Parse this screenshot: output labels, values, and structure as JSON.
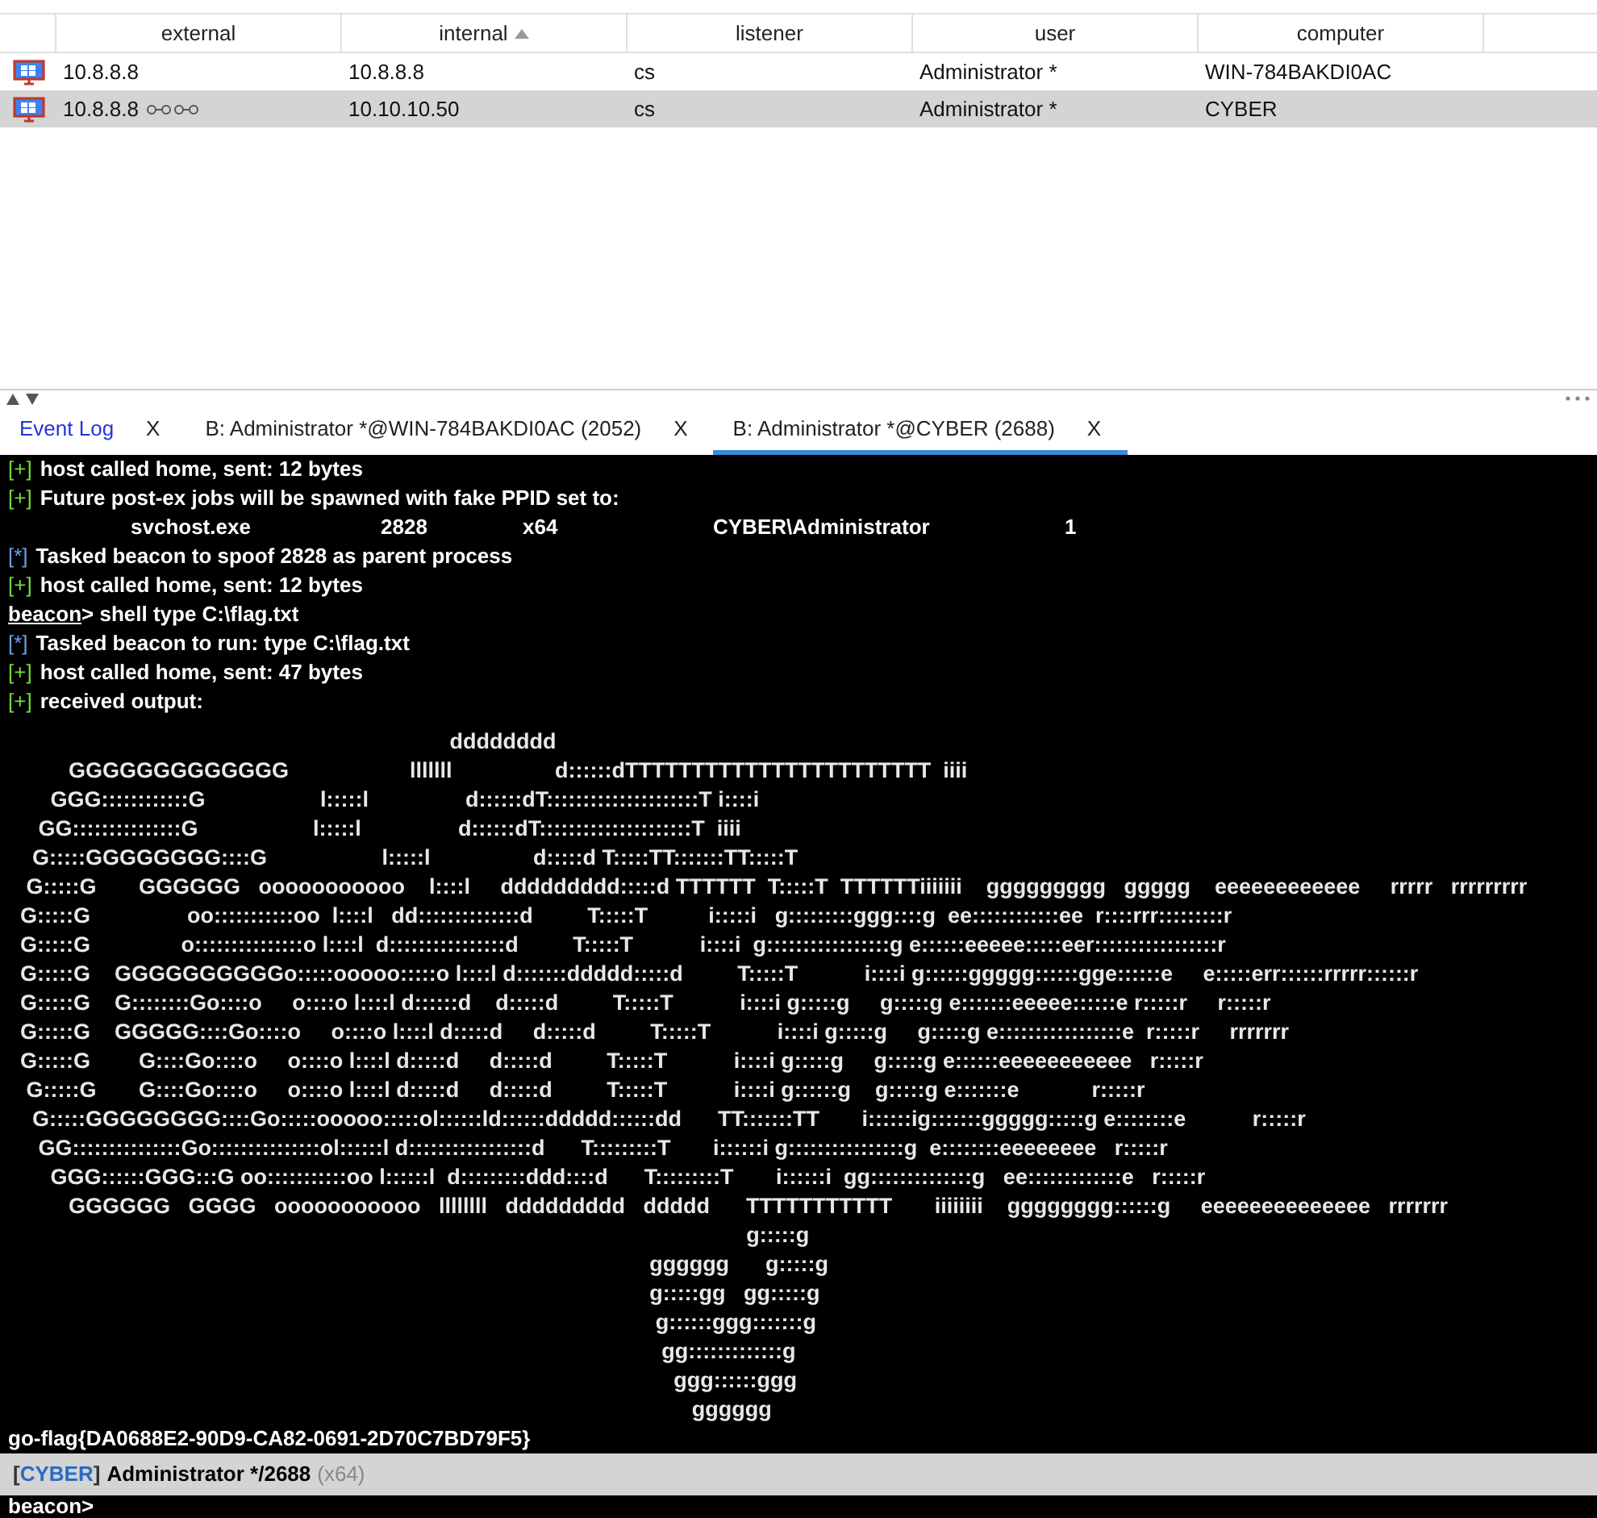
{
  "sessions_table": {
    "columns": [
      {
        "label": "external",
        "sorted": false
      },
      {
        "label": "internal",
        "sorted": true
      },
      {
        "label": "listener",
        "sorted": false
      },
      {
        "label": "user",
        "sorted": false
      },
      {
        "label": "computer",
        "sorted": false
      }
    ],
    "rows": [
      {
        "selected": false,
        "pivot": false,
        "cells": [
          "10.8.8.8",
          "10.8.8.8",
          "cs",
          "Administrator *",
          "WIN-784BAKDI0AC"
        ]
      },
      {
        "selected": true,
        "pivot": true,
        "cells": [
          "10.8.8.8",
          "10.10.10.50",
          "cs",
          "Administrator *",
          "CYBER"
        ]
      }
    ]
  },
  "tabs": [
    {
      "label": "Event Log",
      "close": "X",
      "selected": false,
      "kind": "log"
    },
    {
      "label": "B: Administrator *@WIN-784BAKDI0AC (2052)",
      "close": "X",
      "selected": false,
      "kind": "beacon"
    },
    {
      "label": "B: Administrator *@CYBER (2688)",
      "close": "X",
      "selected": true,
      "kind": "beacon"
    }
  ],
  "console": {
    "lines": [
      {
        "kind": "plus",
        "marker": "[+]",
        "text": "host called home, sent: 12 bytes"
      },
      {
        "kind": "plus",
        "marker": "[+]",
        "text": "Future post-ex jobs will be spawned with fake PPID set to:"
      },
      {
        "kind": "table",
        "cells": [
          "svchost.exe",
          "2828",
          "x64",
          "CYBER\\Administrator",
          "1"
        ]
      },
      {
        "kind": "star",
        "marker": "[*]",
        "text": "Tasked beacon to spoof 2828 as parent process"
      },
      {
        "kind": "plus",
        "marker": "[+]",
        "text": "host called home, sent: 12 bytes"
      },
      {
        "kind": "input",
        "prompt": "beacon",
        "text": "> shell type C:\\flag.txt"
      },
      {
        "kind": "star",
        "marker": "[*]",
        "text": "Tasked beacon to run: type C:\\flag.txt"
      },
      {
        "kind": "plus",
        "marker": "[+]",
        "text": "host called home, sent: 47 bytes"
      },
      {
        "kind": "plus",
        "marker": "[+]",
        "text": "received output:"
      }
    ],
    "art": [
      "                                                                         dddddddd",
      "          GGGGGGGGGGGGG                    lllllll                 d::::::dTTTTTTTTTTTTTTTTTTTTTTT  iiii",
      "       GGG::::::::::::G                   l:::::l                d::::::dT:::::::::::::::::::::T i::::i",
      "     GG:::::::::::::::G                   l:::::l                d::::::dT:::::::::::::::::::::T  iiii",
      "    G:::::GGGGGGGG::::G                   l:::::l                 d:::::d T:::::TT:::::::TT:::::T",
      "   G:::::G       GGGGGG   ooooooooooo    l::::l     ddddddddd:::::d TTTTTT  T:::::T  TTTTTTiiiiiii    ggggggggg   ggggg    eeeeeeeeeeee     rrrrr   rrrrrrrrr",
      "  G:::::G                oo:::::::::::oo  l::::l   dd::::::::::::::d         T:::::T          i:::::i   g:::::::::ggg::::g  ee::::::::::::ee  r::::rrr:::::::::r",
      "  G:::::G               o:::::::::::::::o l::::l  d::::::::::::::::d         T:::::T           i::::i  g:::::::::::::::::g e::::::eeeee:::::eer:::::::::::::::::r",
      "  G:::::G    GGGGGGGGGGo:::::ooooo:::::o l::::l d:::::::ddddd:::::d         T:::::T           i::::i g::::::ggggg::::::gge::::::e     e:::::err::::::rrrrr::::::r",
      "  G:::::G    G::::::::Go::::o     o::::o l::::l d::::::d    d:::::d         T:::::T           i::::i g:::::g     g:::::g e:::::::eeeee::::::e r:::::r     r:::::r",
      "  G:::::G    GGGGG::::Go::::o     o::::o l::::l d:::::d     d:::::d         T:::::T           i::::i g:::::g     g:::::g e:::::::::::::::::e  r:::::r     rrrrrrr",
      "  G:::::G        G::::Go::::o     o::::o l::::l d:::::d     d:::::d         T:::::T           i::::i g:::::g     g:::::g e::::::eeeeeeeeeee   r:::::r",
      "   G:::::G       G::::Go::::o     o::::o l::::l d:::::d     d:::::d         T:::::T           i::::i g::::::g    g:::::g e:::::::e            r:::::r",
      "    G:::::GGGGGGGG::::Go:::::ooooo:::::ol::::::ld::::::ddddd::::::dd      TT:::::::TT       i::::::ig:::::::ggggg:::::g e::::::::e           r:::::r",
      "     GG:::::::::::::::Go:::::::::::::::ol::::::l d:::::::::::::::::d      T:::::::::T       i::::::i g::::::::::::::::g  e::::::::eeeeeeee   r:::::r",
      "       GGG::::::GGG:::G oo:::::::::::oo l::::::l  d:::::::::ddd::::d      T:::::::::T       i::::::i  gg::::::::::::::g   ee:::::::::::::e   r:::::r",
      "          GGGGGG   GGGG   ooooooooooo   llllllll   ddddddddd   ddddd      TTTTTTTTTTT       iiiiiiii    gggggggg::::::g     eeeeeeeeeeeeee   rrrrrrr",
      "                                                                                                                          g:::::g",
      "                                                                                                          gggggg      g:::::g",
      "                                                                                                          g:::::gg   gg:::::g",
      "                                                                                                           g::::::ggg:::::::g",
      "                                                                                                            gg:::::::::::::g",
      "                                                                                                              ggg::::::ggg",
      "                                                                                                                 gggggg"
    ],
    "result": "go-flag{DA0688E2-90D9-CA82-0691-2D70C7BD79F5}"
  },
  "status_bar": {
    "bracket_open": "[",
    "host": "CYBER",
    "bracket_close": "]",
    "user": "Administrator */2688",
    "arch": "(x64)"
  },
  "prompt": "beacon>"
}
